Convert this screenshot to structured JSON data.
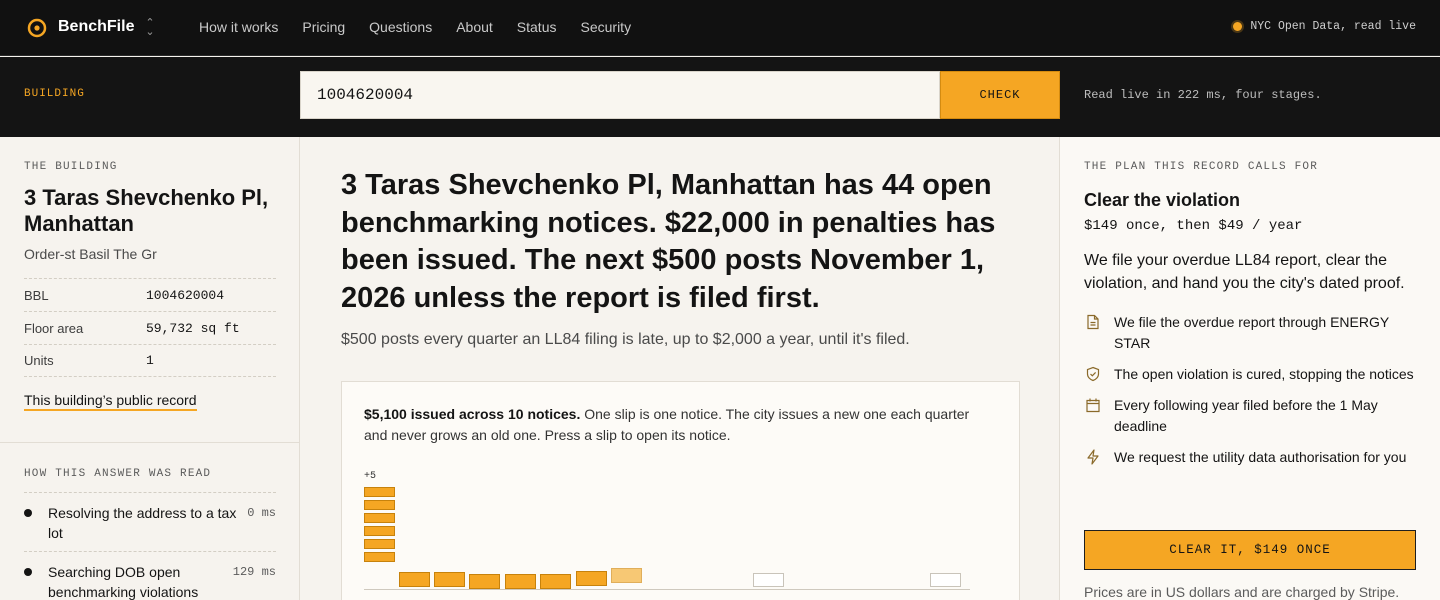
{
  "nav": {
    "brand": "BenchFile",
    "links": [
      "How it works",
      "Pricing",
      "Questions",
      "About",
      "Status",
      "Security"
    ],
    "live_status": "NYC Open Data, read live",
    "accent": "#f5a623"
  },
  "search": {
    "label": "BUILDING",
    "value": "1004620004",
    "button": "CHECK",
    "note": "Read live in 222 ms, four stages."
  },
  "building": {
    "eyebrow": "THE BUILDING",
    "name": "3 Taras Shevchenko Pl, Manhattan",
    "sub": "Order-st Basil The Gr",
    "facts": [
      {
        "k": "BBL",
        "v": "1004620004"
      },
      {
        "k": "Floor area",
        "v": "59,732 sq ft"
      },
      {
        "k": "Units",
        "v": "1"
      }
    ],
    "record_link": "This building’s public record"
  },
  "how": {
    "eyebrow": "HOW THIS ANSWER WAS READ",
    "steps": [
      {
        "t": "Resolving the address to a tax lot",
        "ms": "0 ms"
      },
      {
        "t": "Searching DOB open benchmarking violations",
        "ms": "129 ms"
      }
    ]
  },
  "main": {
    "headline": "3 Taras Shevchenko Pl, Manhattan has 44 open benchmarking notices. $22,000 in penalties has been issued. The next $500 posts November 1, 2026 unless the report is filed first.",
    "subline": "$500 posts every quarter an LL84 filing is late, up to $2,000 a year, until it's filed.",
    "card_bold": "$5,100 issued across 10 notices.",
    "card_text": " One slip is one notice. The city issues a new one each quarter and never grows an old one. Press a slip to open its notice.",
    "overflow_label": "+5",
    "stack_count": 6,
    "slips": [
      {
        "state": "issued"
      },
      {
        "state": "issued"
      },
      {
        "state": "issued"
      },
      {
        "state": "issued"
      },
      {
        "state": "issued"
      },
      {
        "state": "issued"
      },
      {
        "state": "pending"
      },
      {
        "state": "empty"
      },
      {
        "state": "empty"
      }
    ]
  },
  "plan": {
    "eyebrow": "THE PLAN THIS RECORD CALLS FOR",
    "title": "Clear the violation",
    "price": "$149 once, then $49 / year",
    "desc": "We file your overdue LL84 report, clear the violation, and hand you the city's dated proof.",
    "features": [
      {
        "icon": "document-icon",
        "text": "We file the overdue report through ENERGY STAR"
      },
      {
        "icon": "shield-check-icon",
        "text": "The open violation is cured, stopping the notices"
      },
      {
        "icon": "calendar-icon",
        "text": "Every following year filed before the 1 May deadline"
      },
      {
        "icon": "lightning-icon",
        "text": "We request the utility data authorisation for you"
      }
    ],
    "cta": "CLEAR IT, $149 ONCE",
    "fine": "Prices are in US dollars and are charged by Stripe."
  }
}
